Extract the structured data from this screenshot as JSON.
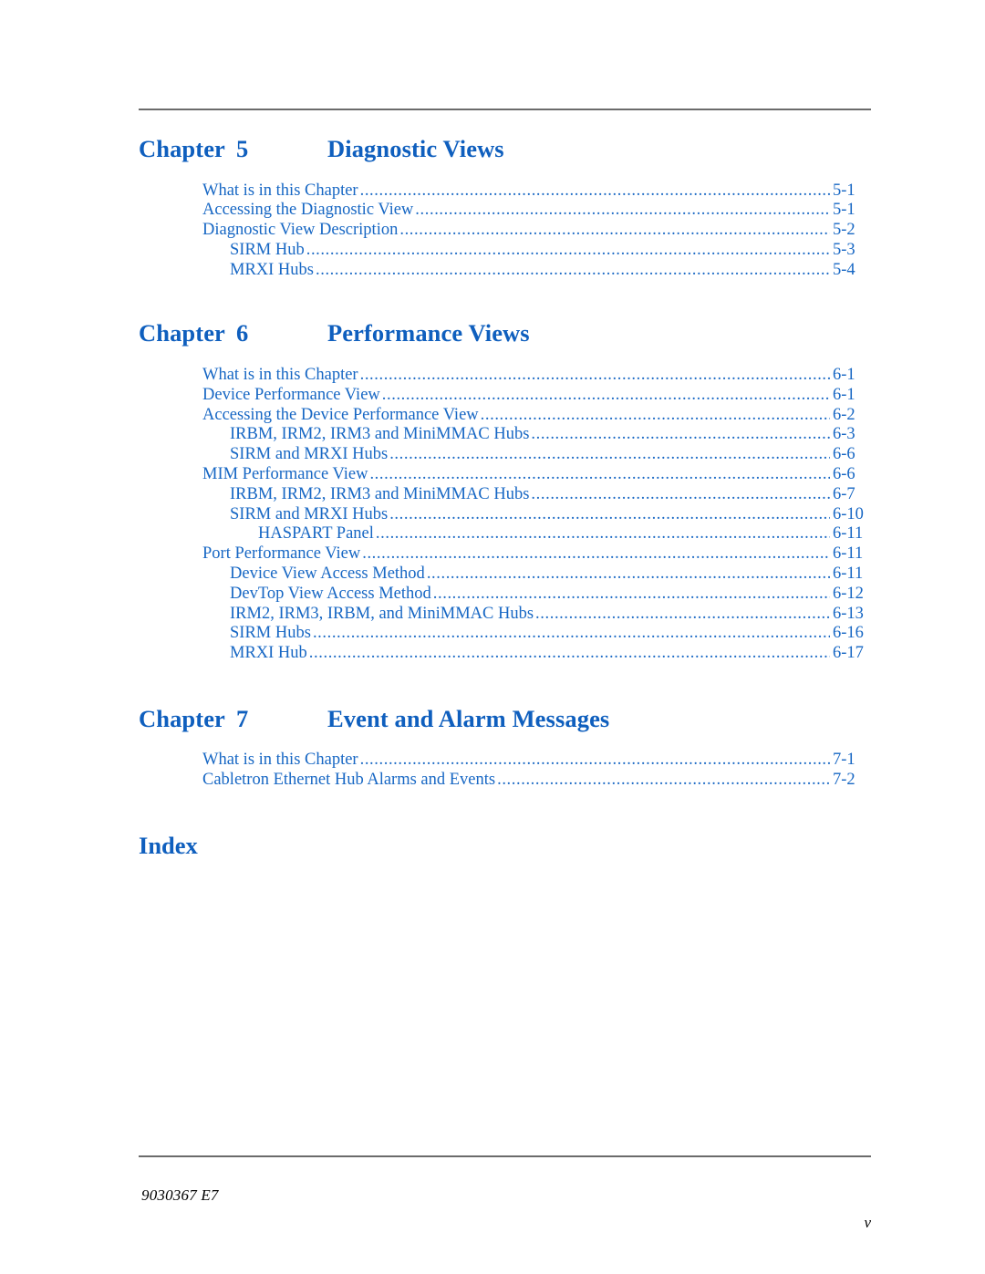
{
  "document": {
    "footer_doc_number": "9030367 E7",
    "footer_page_number": "v",
    "accent_color": "#0f5fbe",
    "toc_text_color": "#1767c4",
    "rule_color": "#6b6b6b"
  },
  "chapters": [
    {
      "label": "Chapter",
      "number": "5",
      "title": "Diagnostic Views",
      "entries": [
        {
          "text": "What is in this Chapter",
          "page": "5-1",
          "level": 1
        },
        {
          "text": "Accessing the Diagnostic View",
          "page": "5-1",
          "level": 1
        },
        {
          "text": "Diagnostic View Description",
          "page": "5-2",
          "level": 1
        },
        {
          "text": "SIRM Hub",
          "page": "5-3",
          "level": 2
        },
        {
          "text": "MRXI Hubs",
          "page": "5-4",
          "level": 2
        }
      ]
    },
    {
      "label": "Chapter",
      "number": "6",
      "title": "Performance Views",
      "entries": [
        {
          "text": "What is in this Chapter",
          "page": "6-1",
          "level": 1
        },
        {
          "text": "Device Performance View",
          "page": "6-1",
          "level": 1
        },
        {
          "text": "Accessing the Device Performance View",
          "page": "6-2",
          "level": 1
        },
        {
          "text": "IRBM, IRM2, IRM3 and MiniMMAC Hubs",
          "page": "6-3",
          "level": 2
        },
        {
          "text": "SIRM and MRXI Hubs",
          "page": "6-6",
          "level": 2
        },
        {
          "text": "MIM Performance View",
          "page": "6-6",
          "level": 1
        },
        {
          "text": "IRBM, IRM2, IRM3 and MiniMMAC Hubs",
          "page": "6-7",
          "level": 2
        },
        {
          "text": "SIRM and MRXI Hubs",
          "page": "6-10",
          "level": 2
        },
        {
          "text": "HASPART Panel",
          "page": "6-11",
          "level": 3
        },
        {
          "text": "Port Performance View",
          "page": "6-11",
          "level": 1
        },
        {
          "text": "Device View Access Method",
          "page": "6-11",
          "level": 2
        },
        {
          "text": "DevTop View Access Method",
          "page": "6-12",
          "level": 2
        },
        {
          "text": "IRM2, IRM3, IRBM, and MiniMMAC Hubs",
          "page": "6-13",
          "level": 2
        },
        {
          "text": "SIRM Hubs",
          "page": "6-16",
          "level": 2
        },
        {
          "text": "MRXI Hub",
          "page": "6-17",
          "level": 2
        }
      ]
    },
    {
      "label": "Chapter",
      "number": "7",
      "title": "Event and Alarm Messages",
      "entries": [
        {
          "text": "What is in this Chapter",
          "page": "7-1",
          "level": 1
        },
        {
          "text": "Cabletron Ethernet Hub Alarms and Events",
          "page": "7-2",
          "level": 1
        }
      ]
    }
  ],
  "index": {
    "title": "Index",
    "entries": []
  }
}
